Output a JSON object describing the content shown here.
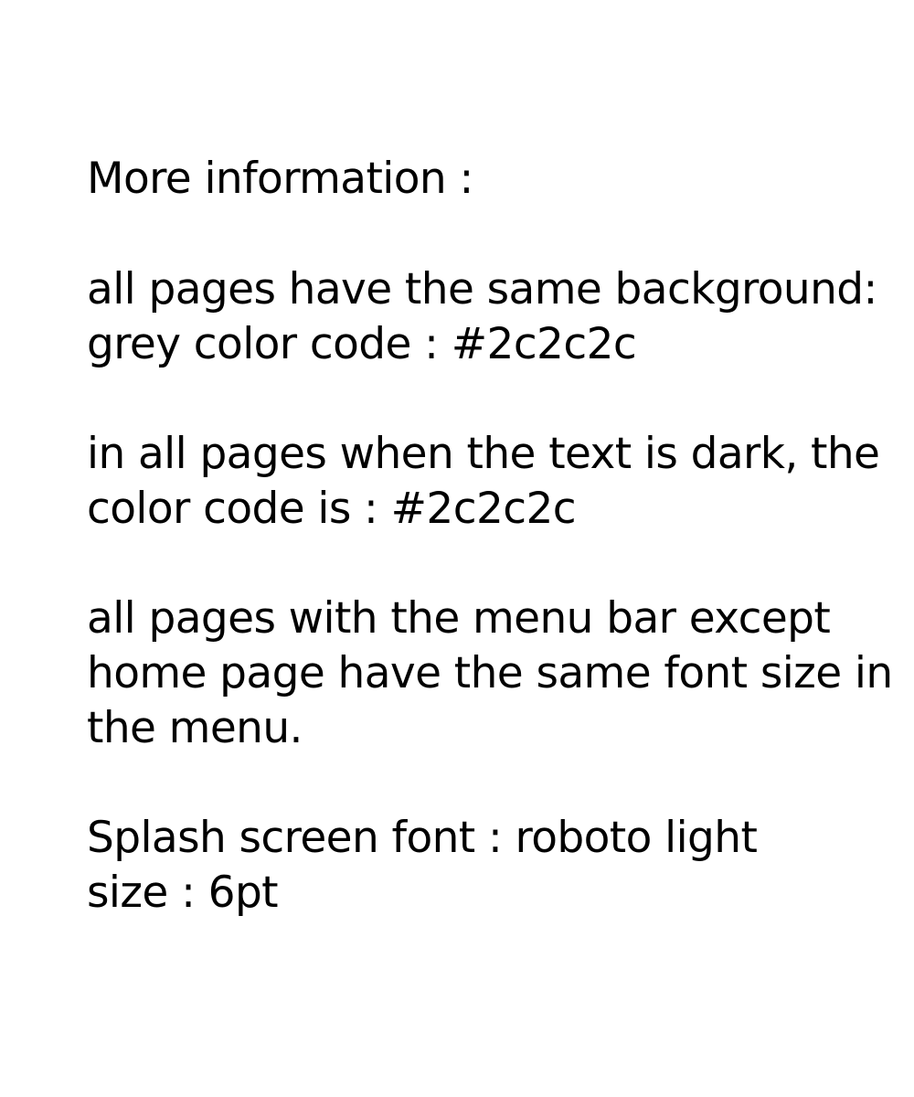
{
  "title": "More information :",
  "notes": [
    {
      "lines": [
        "all pages have the same background:",
        "grey color code : #2c2c2c"
      ]
    },
    {
      "lines": [
        "in all pages when the text is dark, the",
        "color code is : #2c2c2c"
      ]
    },
    {
      "lines": [
        "all pages with the menu bar except",
        "home page have the same font size in",
        "the menu."
      ]
    },
    {
      "lines": [
        "Splash screen font : roboto light",
        "size : 6pt"
      ]
    }
  ]
}
